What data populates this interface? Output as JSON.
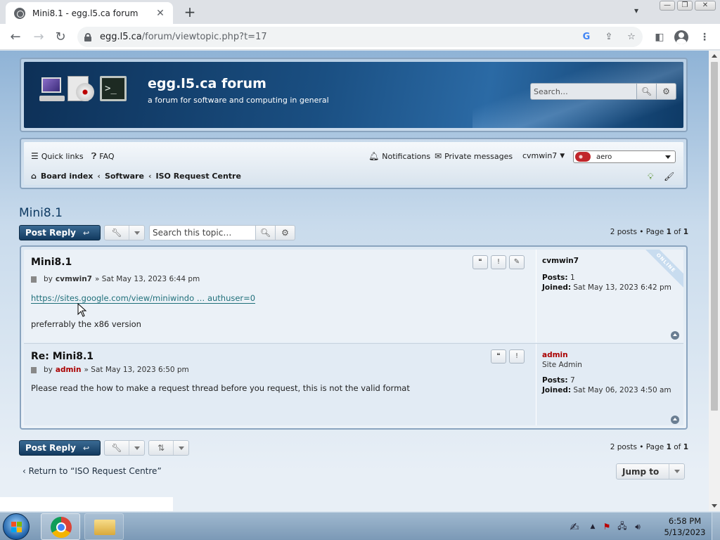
{
  "browser": {
    "tab_title": "Mini8.1 - egg.l5.ca forum",
    "url_host": "egg.l5.ca",
    "url_path": "/forum/viewtopic.php?t=17"
  },
  "header": {
    "site_title": "egg.l5.ca forum",
    "site_description": "a forum for software and computing in general",
    "search_placeholder": "Search…"
  },
  "navbar": {
    "quick_links": "Quick links",
    "faq": "FAQ",
    "notifications": "Notifications",
    "private_messages": "Private messages",
    "username": "cvmwin7",
    "style_value": "aero",
    "breadcrumbs": [
      "Board index",
      "Software",
      "ISO Request Centre"
    ]
  },
  "topic": {
    "title": "Mini8.1",
    "post_reply": "Post Reply",
    "search_placeholder": "Search this topic…",
    "pagination_top": {
      "count": "2 posts",
      "page_label": "Page",
      "current": "1",
      "of": "of",
      "total": "1"
    },
    "pagination_bottom": {
      "count": "2 posts",
      "page_label": "Page",
      "current": "1",
      "of": "of",
      "total": "1"
    }
  },
  "posts": [
    {
      "title": "Mini8.1",
      "by": "by",
      "author": "cvmwin7",
      "date": "» Sat May 13, 2023 6:44 pm",
      "link": "https://sites.google.com/view/miniwindo … authuser=0",
      "body": "preferrably the x86 version",
      "profile": {
        "username": "cvmwin7",
        "rank": "",
        "posts_label": "Posts:",
        "posts": "1",
        "joined_label": "Joined:",
        "joined": "Sat May 13, 2023 6:42 pm",
        "online_badge": "ONLINE"
      }
    },
    {
      "title": "Re: Mini8.1",
      "by": "by",
      "author": "admin",
      "date": "» Sat May 13, 2023 6:50 pm",
      "body": "Please read the how to make a request thread before you request, this is not the valid format",
      "profile": {
        "username": "admin",
        "rank": "Site Admin",
        "posts_label": "Posts:",
        "posts": "7",
        "joined_label": "Joined:",
        "joined": "Sat May 06, 2023 4:50 am"
      }
    }
  ],
  "footer": {
    "return_link": "Return to “ISO Request Centre”",
    "jump_to": "Jump to"
  },
  "taskbar": {
    "time": "6:58 PM",
    "date": "5/13/2023"
  }
}
